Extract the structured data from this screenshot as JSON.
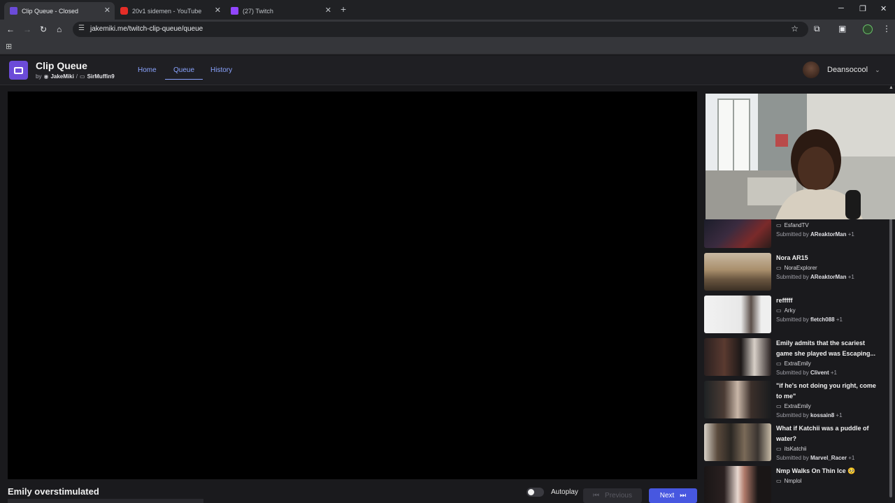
{
  "browser": {
    "tabs": [
      {
        "title": "Clip Queue - Closed",
        "favicon_color": "#6b4bd8",
        "active": true
      },
      {
        "title": "20v1 sidemen - YouTube",
        "favicon_color": "#e52d27",
        "active": false
      },
      {
        "title": "(27) Twitch",
        "favicon_color": "#9146ff",
        "active": false
      }
    ],
    "url": "jakemiki.me/twitch-clip-queue/queue"
  },
  "app": {
    "title": "Clip Queue",
    "by": "by",
    "author1": "JakeMiki",
    "separator": "/",
    "author2": "SirMuffin9",
    "nav": [
      "Home",
      "Queue",
      "History"
    ],
    "active_nav": "Queue",
    "user": "Deansocool",
    "accent": "#6b4bd8"
  },
  "player": {
    "clip_title": "Emily overstimulated",
    "autoplay_label": "Autoplay",
    "autoplay_on": false,
    "previous_label": "Previous",
    "next_label": "Next",
    "next_color": "#4757e0"
  },
  "queue": [
    {
      "title": "",
      "channel": "EsfandTV",
      "submitted_prefix": "Submitted by",
      "submitter": "AReaktorMan",
      "extra": "+1"
    },
    {
      "title": "Nora AR15",
      "channel": "NoraExplorer",
      "submitted_prefix": "Submitted by",
      "submitter": "AReaktorMan",
      "extra": "+1"
    },
    {
      "title": "refffff",
      "channel": "Arky",
      "submitted_prefix": "Submitted by",
      "submitter": "fletch088",
      "extra": "+1"
    },
    {
      "title": "Emily admits that the scariest game she played was Escaping...",
      "channel": "ExtraEmily",
      "submitted_prefix": "Submitted by",
      "submitter": "Clivent",
      "extra": "+1"
    },
    {
      "title": "\"if he's not doing you right, come to me\"",
      "channel": "ExtraEmily",
      "submitted_prefix": "Submitted by",
      "submitter": "kossain8",
      "extra": "+1"
    },
    {
      "title": "What if Katchii was a puddle of water?",
      "channel": "itsKatchii",
      "submitted_prefix": "Submitted by",
      "submitter": "Marvel_Racer",
      "extra": "+1"
    },
    {
      "title": "Nmp Walks On Thin Ice 🥺",
      "channel": "Nmplol",
      "submitted_prefix": "",
      "submitter": "",
      "extra": ""
    }
  ]
}
